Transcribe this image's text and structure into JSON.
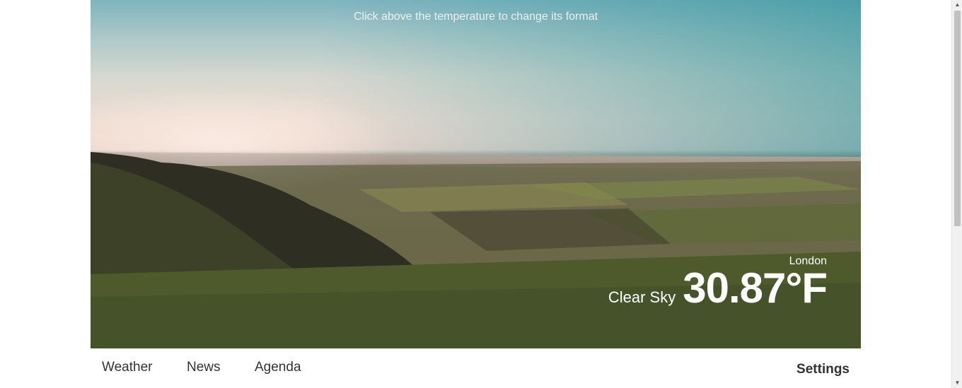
{
  "hero": {
    "hint": "Click above the temperature to change its format"
  },
  "weather": {
    "city": "London",
    "condition": "Clear Sky",
    "temperature": "30.87°F"
  },
  "nav": {
    "items": [
      {
        "label": "Weather"
      },
      {
        "label": "News"
      },
      {
        "label": "Agenda"
      }
    ],
    "settings_label": "Settings"
  },
  "icons": {
    "scroll_up": "triangle-up",
    "scroll_down": "triangle-down"
  },
  "colors": {
    "nav_text": "#333333",
    "overlay_text": "#ffffff"
  }
}
